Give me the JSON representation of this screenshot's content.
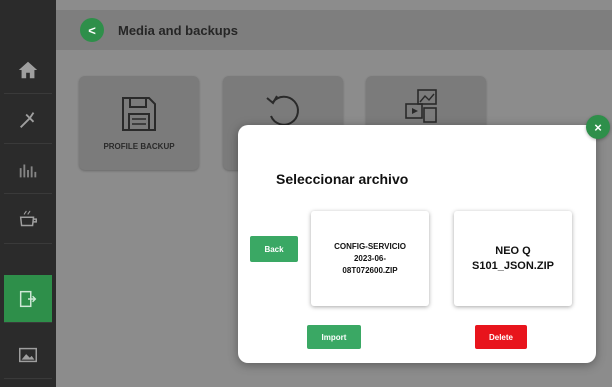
{
  "header": {
    "back_glyph": "<",
    "title": "Media and backups"
  },
  "sidebar": {
    "items": [
      {
        "icon": "home-icon"
      },
      {
        "icon": "tools-icon"
      },
      {
        "icon": "chart-icon"
      },
      {
        "icon": "cup-icon"
      },
      {
        "icon": "media-backup-icon",
        "active": true
      },
      {
        "icon": "image-icon"
      }
    ]
  },
  "tiles": [
    {
      "label": "PROFILE BACKUP",
      "icon": "save-icon"
    },
    {
      "label": "",
      "icon": "restore-icon"
    },
    {
      "label": "",
      "icon": "media-files-icon"
    }
  ],
  "modal": {
    "close_glyph": "×",
    "title": "Seleccionar archivo",
    "back_label": "Back",
    "files": [
      {
        "line1": "CONFIG-SERVICIO",
        "line2": "2023-06-",
        "line3": "08T072600.ZIP"
      },
      {
        "line1": "NEO Q",
        "line2": "S101_JSON.ZIP"
      }
    ],
    "import_label": "Import",
    "delete_label": "Delete"
  },
  "colors": {
    "accent_green": "#2e8f4a",
    "button_green": "#3aa864",
    "danger_red": "#e8141c",
    "sidebar_bg": "#2b2b2b"
  }
}
